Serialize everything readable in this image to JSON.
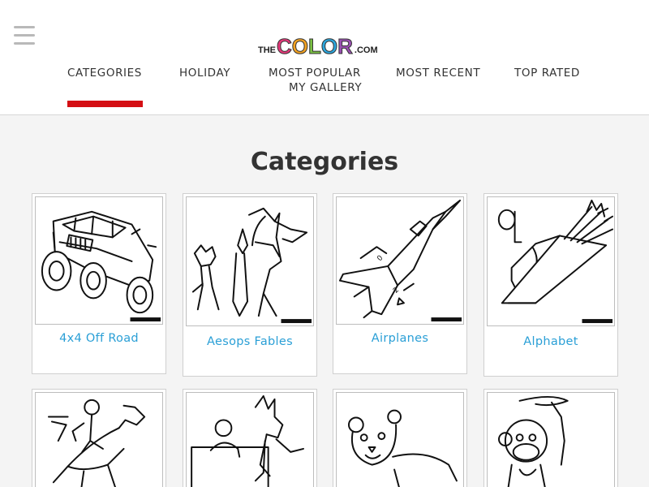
{
  "header": {
    "logo": {
      "prefix": "THE",
      "letters": [
        {
          "char": "C",
          "color": "#e5397a"
        },
        {
          "char": "O",
          "color": "#f3a221"
        },
        {
          "char": "L",
          "color": "#7ac043"
        },
        {
          "char": "O",
          "color": "#2ba6dd"
        },
        {
          "char": "R",
          "color": "#9b4fb3"
        }
      ],
      "suffix": ".COM"
    },
    "nav": {
      "categories": "CATEGORIES",
      "holiday": "HOLIDAY",
      "most_popular": "MOST POPULAR",
      "most_recent": "MOST RECENT",
      "top_rated": "TOP RATED",
      "my_gallery": "MY GALLERY",
      "active": "CATEGORIES"
    }
  },
  "main": {
    "title": "Categories",
    "categories": [
      {
        "label": "4x4 Off Road",
        "icon": "offroad-truck-icon"
      },
      {
        "label": "Aesops Fables",
        "icon": "fox-stork-icon"
      },
      {
        "label": "Airplanes",
        "icon": "jet-fighter-icon"
      },
      {
        "label": "Alphabet",
        "icon": "letter-q-quiver-icon"
      },
      {
        "label": "",
        "icon": "carousel-horse-icon"
      },
      {
        "label": "",
        "icon": "animals-cartoon-icon"
      },
      {
        "label": "",
        "icon": "lion-cub-icon"
      },
      {
        "label": "",
        "icon": "monkey-icon"
      }
    ]
  },
  "colors": {
    "accent": "#d40f14",
    "link": "#2a9fd6",
    "background": "#f4f4f4"
  }
}
